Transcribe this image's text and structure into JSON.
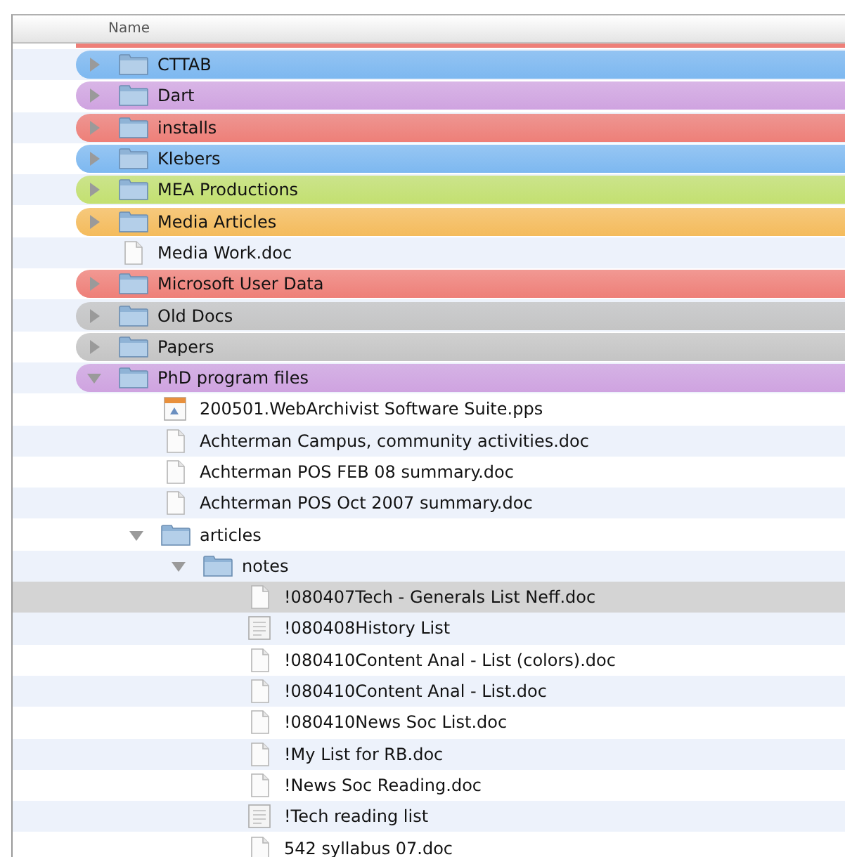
{
  "header": {
    "column": "Name"
  },
  "items": [
    {
      "name": "CTTAB",
      "kind": "folder",
      "color": "#7db8f0",
      "expanded": false,
      "selected": false
    },
    {
      "name": "Dart",
      "kind": "folder",
      "color": "#cfa3e0",
      "expanded": false,
      "selected": false
    },
    {
      "name": "installs",
      "kind": "folder",
      "color": "#ee7f78",
      "expanded": false,
      "selected": false
    },
    {
      "name": "Klebers",
      "kind": "folder",
      "color": "#7db8f0",
      "expanded": false,
      "selected": false
    },
    {
      "name": "MEA Productions",
      "kind": "folder",
      "color": "#c3e070",
      "expanded": false,
      "selected": false
    },
    {
      "name": "Media Articles",
      "kind": "folder",
      "color": "#f4bb5c",
      "expanded": false,
      "selected": false
    },
    {
      "name": "Media Work.doc",
      "kind": "document",
      "selected": false
    },
    {
      "name": "Microsoft User Data",
      "kind": "folder",
      "color": "#ee7f78",
      "expanded": false,
      "selected": false
    },
    {
      "name": "Old Docs",
      "kind": "folder",
      "color": "#c4c4c4",
      "expanded": false,
      "selected": false
    },
    {
      "name": "Papers",
      "kind": "folder",
      "color": "#c4c4c4",
      "expanded": false,
      "selected": false
    },
    {
      "name": "PhD program files",
      "kind": "folder",
      "color": "#cfa3e0",
      "expanded": true,
      "selected": false,
      "children": [
        {
          "name": "200501.WebArchivist Software Suite.pps",
          "kind": "presentation",
          "selected": false
        },
        {
          "name": "Achterman Campus, community activities.doc",
          "kind": "document",
          "selected": false
        },
        {
          "name": "Achterman POS FEB 08 summary.doc",
          "kind": "document",
          "selected": false
        },
        {
          "name": "Achterman POS Oct 2007 summary.doc",
          "kind": "document",
          "selected": false
        },
        {
          "name": "articles",
          "kind": "folder",
          "expanded": true,
          "selected": false,
          "children": [
            {
              "name": "notes",
              "kind": "folder",
              "expanded": true,
              "selected": false,
              "children": [
                {
                  "name": "!080407Tech - Generals List Neff.doc",
                  "kind": "document",
                  "selected": true
                },
                {
                  "name": "!080408History List",
                  "kind": "list",
                  "selected": false
                },
                {
                  "name": "!080410Content Anal - List (colors).doc",
                  "kind": "document",
                  "selected": false
                },
                {
                  "name": "!080410Content Anal - List.doc",
                  "kind": "document",
                  "selected": false
                },
                {
                  "name": "!080410News Soc List.doc",
                  "kind": "document",
                  "selected": false
                },
                {
                  "name": "!My List for RB.doc",
                  "kind": "document",
                  "selected": false
                },
                {
                  "name": "!News Soc Reading.doc",
                  "kind": "document",
                  "selected": false
                },
                {
                  "name": "!Tech reading list",
                  "kind": "list",
                  "selected": false
                },
                {
                  "name": "542 syllabus 07.doc",
                  "kind": "document",
                  "selected": false
                }
              ]
            }
          ]
        }
      ]
    }
  ]
}
